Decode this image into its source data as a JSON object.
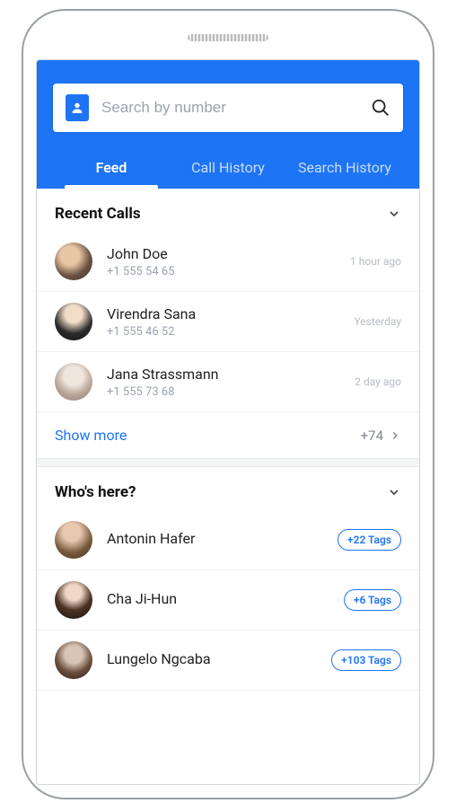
{
  "search": {
    "placeholder": "Search by number"
  },
  "tabs": {
    "feed": "Feed",
    "call_history": "Call History",
    "search_history": "Search History"
  },
  "sections": {
    "recent_calls": {
      "title": "Recent Calls",
      "items": [
        {
          "name": "John Doe",
          "number": "+1 555 54 65",
          "meta": "1 hour ago"
        },
        {
          "name": "Virendra Sana",
          "number": "+1 555 46 52",
          "meta": "Yesterday"
        },
        {
          "name": "Jana Strassmann",
          "number": "+1 555 73 68",
          "meta": "2 day ago"
        }
      ],
      "show_more_label": "Show more",
      "show_more_count": "+74"
    },
    "whos_here": {
      "title": "Who's here?",
      "items": [
        {
          "name": "Antonin Hafer",
          "tag": "+22 Tags"
        },
        {
          "name": "Cha Ji-Hun",
          "tag": "+6 Tags"
        },
        {
          "name": "Lungelo Ngcaba",
          "tag": "+103 Tags"
        }
      ]
    }
  }
}
